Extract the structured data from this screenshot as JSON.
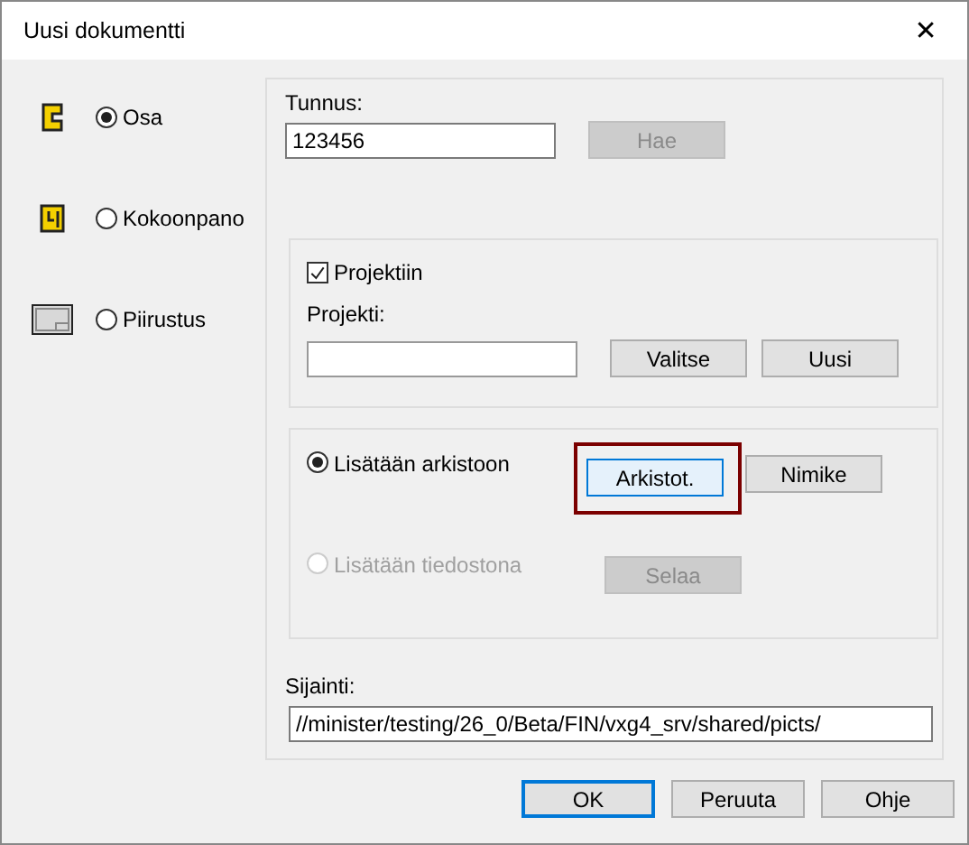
{
  "window": {
    "title": "Uusi dokumentti",
    "close": "✕"
  },
  "doc_types": [
    {
      "kind": "part",
      "label": "Osa",
      "selected": true
    },
    {
      "kind": "assembly",
      "label": "Kokoonpano",
      "selected": false
    },
    {
      "kind": "drawing",
      "label": "Piirustus",
      "selected": false
    }
  ],
  "tunnus": {
    "label": "Tunnus:",
    "value": "123456",
    "button": {
      "label": "Hae",
      "disabled": true
    }
  },
  "project": {
    "checkbox": {
      "label": "Projektiin",
      "checked": true
    },
    "label": "Projekti:",
    "buttons": [
      {
        "label": "Valitse"
      },
      {
        "label": "Uusi"
      }
    ]
  },
  "storage": {
    "options": [
      {
        "label": "Lisätään arkistoon",
        "selected": true,
        "disabled": false,
        "buttons": [
          {
            "label": "Arkistot.",
            "focused": true,
            "highlighted": true,
            "disabled": false
          },
          {
            "label": "Nimike",
            "focused": false,
            "highlighted": false,
            "disabled": false
          }
        ]
      },
      {
        "label": "Lisätään tiedostona",
        "selected": false,
        "disabled": true,
        "buttons": [
          {
            "label": "Selaa",
            "focused": false,
            "highlighted": false,
            "disabled": true
          }
        ]
      }
    ]
  },
  "location": {
    "label": "Sijainti:",
    "value": "//minister/testing/26_0/Beta/FIN/vxg4_srv/shared/picts/"
  },
  "buttons": [
    {
      "label": "OK",
      "default": true
    },
    {
      "label": "Peruuta",
      "default": false
    },
    {
      "label": "Ohje",
      "default": false
    }
  ]
}
